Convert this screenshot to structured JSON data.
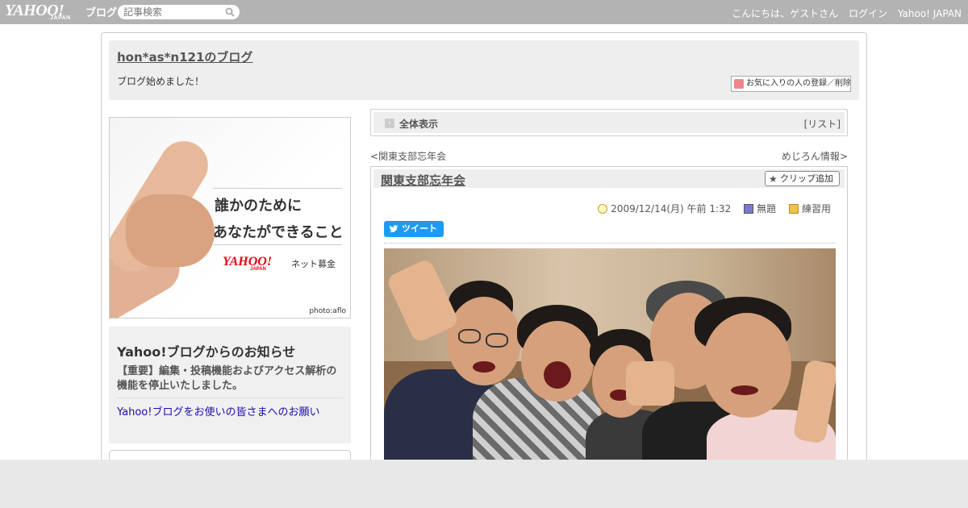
{
  "topbar": {
    "logo_text": "YAHOO!",
    "logo_sub": "JAPAN",
    "logo_service": "ブログ",
    "search_placeholder": "記事検索",
    "greeting": "こんにちは、ゲストさん",
    "login": "ログイン",
    "yahoo_japan": "Yahoo! JAPAN"
  },
  "blog": {
    "title": "hon*as*n121のブログ",
    "description": "ブログ始めました！",
    "favorite_button": "お気に入りの人の登録／削除"
  },
  "banner": {
    "line1": "誰かのために",
    "line2": "あなたができること",
    "logo": "YAHOO!",
    "logo_sub": "JAPAN",
    "service": "ネット募金",
    "credit": "photo:aflo"
  },
  "notice": {
    "heading": "Yahoo!ブログからのお知らせ",
    "item1": "【重要】編集・投稿機能およびアクセス解析の機能を停止いたしました。",
    "item2": "Yahoo!ブログをお使いの皆さまへのお願い"
  },
  "viewbar": {
    "label": "全体表示",
    "list_open": "[",
    "list_label": "リスト",
    "list_close": "]"
  },
  "nav": {
    "prev_mark": "<",
    "prev_label": "関東支部忘年会",
    "next_label": "めじろん情報",
    "next_mark": ">"
  },
  "article": {
    "title": "関東支部忘年会",
    "clip_button": "クリップ追加",
    "date": "2009/12/14(月) 午前 1:32",
    "theme": "無題",
    "category": "練習用",
    "tweet": "ツイート"
  },
  "colors": {
    "topbar": "#b3b3b3",
    "tweet": "#1d9bf0",
    "link_blue": "#1a0dab"
  },
  "icons": [
    "search-icon",
    "heart-icon",
    "arrow-icon",
    "star-icon",
    "clock-icon",
    "book-icon",
    "folder-icon",
    "twitter-bird-icon"
  ]
}
